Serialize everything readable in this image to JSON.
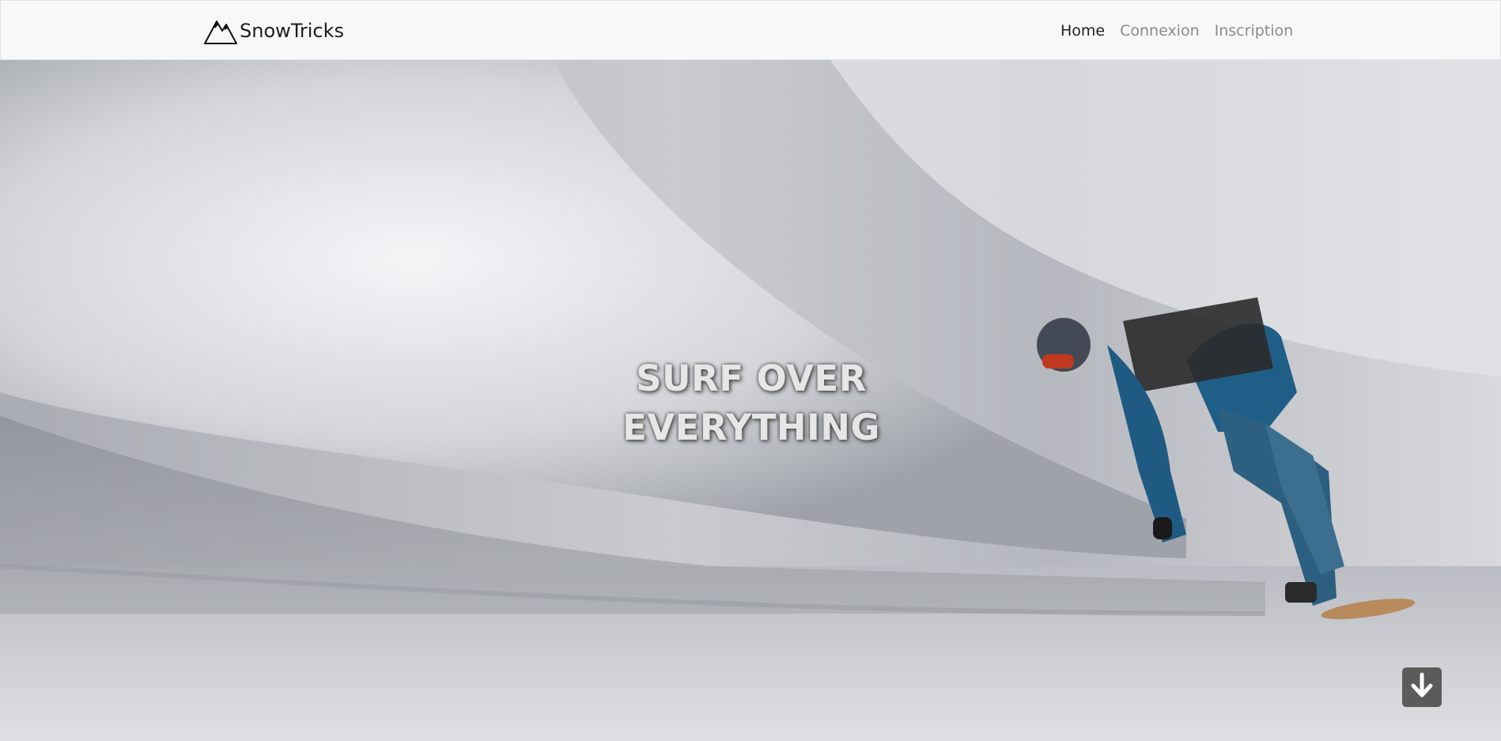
{
  "navbar": {
    "brand": "SnowTricks",
    "links": [
      {
        "label": "Home",
        "active": true
      },
      {
        "label": "Connexion",
        "active": false
      },
      {
        "label": "Inscription",
        "active": false
      }
    ]
  },
  "hero": {
    "headline_line1": "SURF OVER",
    "headline_line2": "EVERYTHING",
    "scroll_icon": "arrow-down-icon"
  },
  "colors": {
    "navbar_bg": "#f8f8f8",
    "active_link": "#222222",
    "inactive_link": "#8a8a8a",
    "scroll_button": "#5b5b5b"
  }
}
